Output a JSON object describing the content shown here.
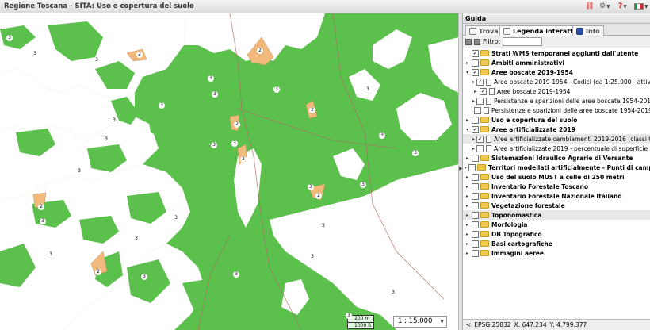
{
  "app": {
    "title": "Regione Toscana - SITA: Uso e copertura del suolo"
  },
  "toolbar": {
    "flag_colors": [
      "#009246",
      "#ffffff",
      "#ce2b37"
    ]
  },
  "map": {
    "colors": {
      "forest": "#5bc04c",
      "open": "#ffffff",
      "artificial": "#f1b97b",
      "road": "#b06a64"
    },
    "scalebar": {
      "metric": "200 m",
      "imperial": "1000 ft"
    },
    "scale": "1 : 15.000",
    "labels": {
      "three": "3",
      "two": "2"
    }
  },
  "panel": {
    "title": "Guida",
    "tabs": {
      "trova": "Trova",
      "legenda": "Legenda interattiva",
      "info": "Info"
    },
    "filter_label": "Filtro:",
    "filter_value": "",
    "layers": [
      {
        "label": "Strati WMS temporanei aggiunti dall'utente",
        "checked": "✓",
        "bold": true,
        "type": "folder",
        "indent": 0,
        "expander": ""
      },
      {
        "label": "Ambiti amministrativi",
        "checked": "",
        "bold": true,
        "type": "folder",
        "indent": 0,
        "expander": "▸"
      },
      {
        "label": "Aree boscate 2019-1954",
        "checked": "✓",
        "bold": true,
        "type": "folder",
        "indent": 0,
        "expander": "▾"
      },
      {
        "label": "Aree boscate 2019-1954 - Codici (da 1:25.000 - attivare per interrog",
        "checked": "✓",
        "bold": false,
        "type": "doc",
        "indent": 1,
        "expander": "▸"
      },
      {
        "label": "Aree boscate 2019-1954",
        "checked": "✓",
        "bold": false,
        "type": "doc",
        "indent": 1,
        "expander": "▸"
      },
      {
        "label": "Persistenze e sparizioni delle aree boscate 1954-2019 - Codici (da 1:",
        "checked": "",
        "bold": false,
        "type": "doc",
        "indent": 1,
        "expander": "▸"
      },
      {
        "label": "Persistenze e sparizioni delle aree boscate 1954-2019",
        "checked": "",
        "bold": false,
        "type": "doc",
        "indent": 1,
        "expander": ""
      },
      {
        "label": "Uso e copertura del suolo",
        "checked": "",
        "bold": true,
        "type": "folder",
        "indent": 0,
        "expander": "▸"
      },
      {
        "label": "Aree artificializzate 2019",
        "checked": "✓",
        "bold": true,
        "type": "folder",
        "indent": 0,
        "expander": "▾"
      },
      {
        "label": "Aree artificializzate cambiamenti 2019-2016 (classi CLC 1)- (scala 1:2",
        "checked": "✓",
        "bold": false,
        "type": "doc",
        "indent": 1,
        "expander": "▸",
        "highlight": true
      },
      {
        "label": "Aree artificializzate 2019 - percentuale di superficie potenzialmente in",
        "checked": "",
        "bold": false,
        "type": "doc",
        "indent": 1,
        "expander": "▸"
      },
      {
        "label": "Sistemazioni Idraulico Agrarie di Versante",
        "checked": "",
        "bold": true,
        "type": "folder",
        "indent": 0,
        "expander": "▸"
      },
      {
        "label": "Territori modellati artificialmente - Punti di campionamento",
        "checked": "",
        "bold": true,
        "type": "folder",
        "indent": 0,
        "expander": "▸"
      },
      {
        "label": "Uso del suolo MUST a celle di 250 metri",
        "checked": "",
        "bold": true,
        "type": "folder",
        "indent": 0,
        "expander": "▸"
      },
      {
        "label": "Inventario Forestale Toscano",
        "checked": "",
        "bold": true,
        "type": "folder",
        "indent": 0,
        "expander": "▸"
      },
      {
        "label": "Inventario Forestale Nazionale Italiano",
        "checked": "",
        "bold": true,
        "type": "folder",
        "indent": 0,
        "expander": "▸"
      },
      {
        "label": "Vegetazione forestale",
        "checked": "",
        "bold": true,
        "type": "folder",
        "indent": 0,
        "expander": "▸"
      },
      {
        "label": "Toponomastica",
        "checked": "",
        "bold": true,
        "type": "folder",
        "indent": 0,
        "expander": "▸",
        "highlight": true
      },
      {
        "label": "Morfologia",
        "checked": "",
        "bold": true,
        "type": "folder",
        "indent": 0,
        "expander": "▸"
      },
      {
        "label": "DB Topografico",
        "checked": "",
        "bold": true,
        "type": "folder",
        "indent": 0,
        "expander": "▸"
      },
      {
        "label": "Basi cartografiche",
        "checked": "",
        "bold": true,
        "type": "folder",
        "indent": 0,
        "expander": "▸"
      },
      {
        "label": "Immagini aeree",
        "checked": "",
        "bold": true,
        "type": "folder",
        "indent": 0,
        "expander": "▸"
      }
    ],
    "status": {
      "arrow": "<",
      "epsg": "EPSG:25832",
      "x": "X: 647.234",
      "y": "Y: 4.799.377"
    }
  }
}
